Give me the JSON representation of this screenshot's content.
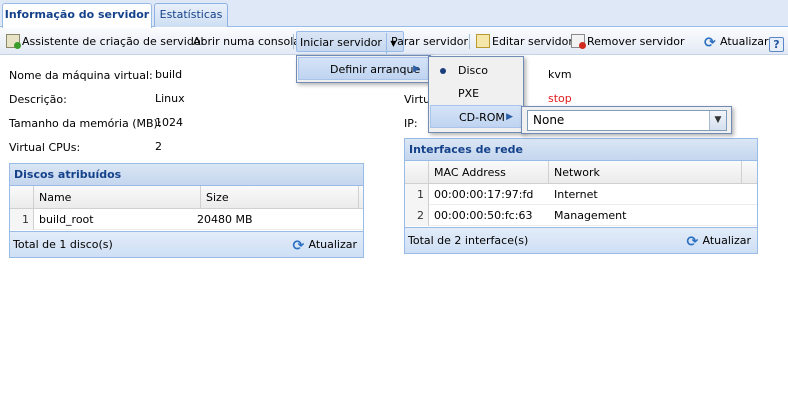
{
  "tabs": [
    {
      "label": "Informação do servidor",
      "active": true
    },
    {
      "label": "Estatísticas",
      "active": false
    }
  ],
  "toolbar": {
    "wizard": "Assistente de criação de servidor",
    "console": "Abrir numa consola",
    "start": "Iniciar servidor",
    "stop": "Parar servidor",
    "edit": "Editar servidor",
    "remove": "Remover servidor",
    "refresh": "Atualizar",
    "help": "?"
  },
  "info": {
    "name_label": "Nome da máquina virtual:",
    "name_value": "build",
    "desc_label": "Descrição:",
    "desc_value": "Linux",
    "mem_label": "Tamanho da memória (MB):",
    "mem_value": "1024",
    "cpu_label": "Virtual CPUs:",
    "cpu_value": "2",
    "virt_label": "Virtu",
    "virt_value": "kvm",
    "status_value": "stop",
    "ip_label": "IP:"
  },
  "disks": {
    "title": "Discos atribuídos",
    "columns": [
      "Name",
      "Size"
    ],
    "rows": [
      {
        "n": "1",
        "name": "build_root",
        "size": "20480 MB"
      }
    ],
    "footer": "Total de 1 disco(s)",
    "refresh": "Atualizar"
  },
  "nics": {
    "title": "Interfaces de rede",
    "columns": [
      "MAC Address",
      "Network"
    ],
    "rows": [
      {
        "n": "1",
        "mac": "00:00:00:17:97:fd",
        "network": "Internet"
      },
      {
        "n": "2",
        "mac": "00:00:00:50:fc:63",
        "network": "Management"
      }
    ],
    "footer": "Total de 2 interface(s)",
    "refresh": "Atualizar"
  },
  "menu": {
    "boot": "Definir arranque",
    "options": [
      {
        "label": "Disco",
        "selected": true
      },
      {
        "label": "PXE",
        "selected": false
      },
      {
        "label": "CD-ROM",
        "selected": false
      }
    ],
    "cdrom_value": "None"
  },
  "colors": {
    "accent": "#15428b",
    "status_stop": "#e21c1c"
  }
}
